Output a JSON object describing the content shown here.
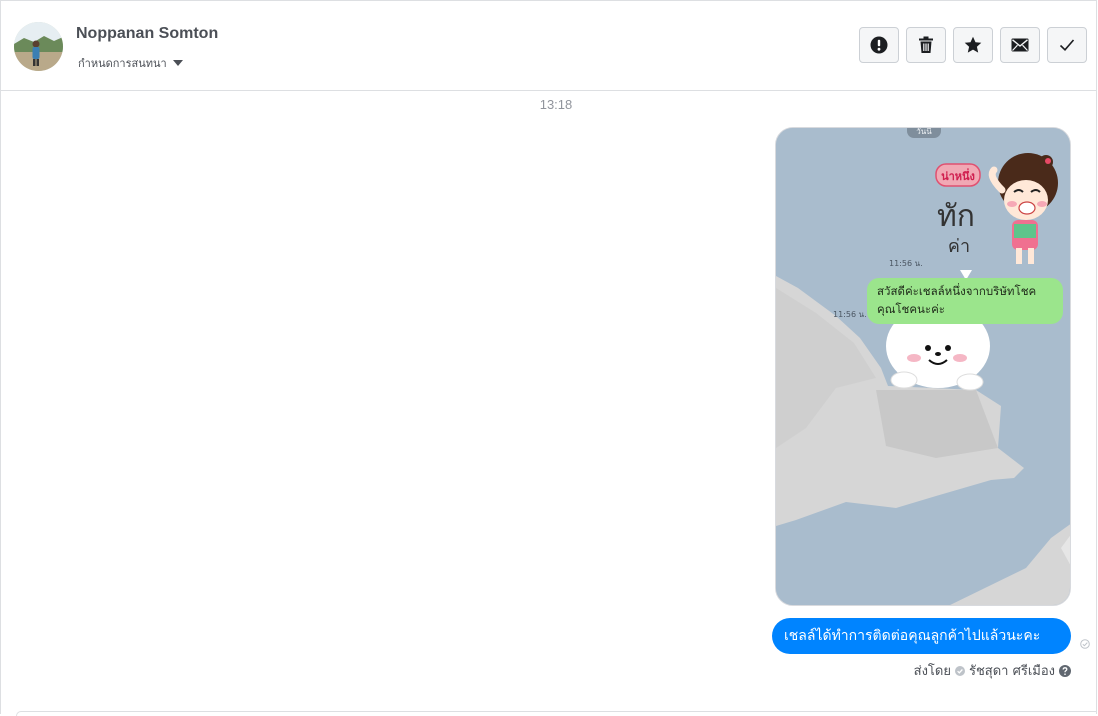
{
  "header": {
    "contact_name": "Noppanan Somton",
    "label_action": "กำหนดการสนทนา",
    "actions": [
      {
        "name": "report",
        "icon": "exclamation-icon"
      },
      {
        "name": "delete",
        "icon": "trash-icon"
      },
      {
        "name": "star",
        "icon": "star-icon"
      },
      {
        "name": "mark-unread",
        "icon": "envelope-icon"
      },
      {
        "name": "mark-done",
        "icon": "check-icon"
      }
    ]
  },
  "conversation": {
    "timestamp": "13:18",
    "image_message": {
      "sticker_badge": "น่าหนึ่ง",
      "sticker_text_line1": "ทัก",
      "sticker_text_line2": "ค่า",
      "time_1": "11:56 น.",
      "time_2": "11:56 น.",
      "chat_bubble_line1": "สวัสดีค่ะเชลล์หนึ่งจากบริษัทโชค",
      "chat_bubble_line2": "คุณโชคนะค่ะ",
      "top_chip": "วันนี้"
    },
    "text_message": "เชลล์ได้ทำการติดต่อคุณลูกค้าไปแล้วนะคะ",
    "sent_by_label": "ส่งโดย",
    "sender_name": "รัชสุดา ศรีเมือง"
  },
  "colors": {
    "accent": "#0084ff",
    "border": "#dddfe2",
    "line_green": "#9be58c",
    "screenshot_bg": "#a9bccd"
  }
}
